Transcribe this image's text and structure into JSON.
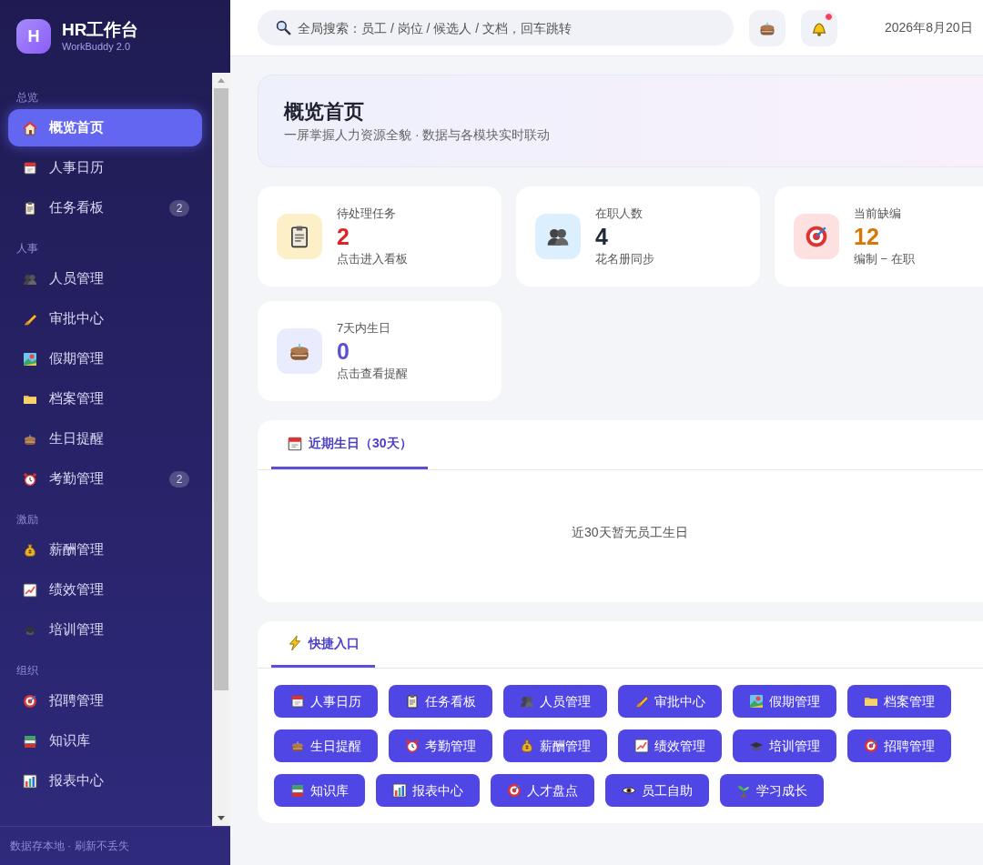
{
  "brand": {
    "logo_letter": "H",
    "title": "HR工作台",
    "subtitle": "WorkBuddy 2.0"
  },
  "sidebar": {
    "sections": [
      {
        "title": "总览",
        "items": [
          {
            "label": "概览首页",
            "selected": true
          },
          {
            "label": "人事日历",
            "selected": false
          },
          {
            "label": "任务看板",
            "selected": false,
            "badge": "2"
          }
        ]
      },
      {
        "title": "人事",
        "items": [
          {
            "label": "人员管理",
            "selected": false
          },
          {
            "label": "审批中心",
            "selected": false
          },
          {
            "label": "假期管理",
            "selected": false
          },
          {
            "label": "档案管理",
            "selected": false
          },
          {
            "label": "生日提醒",
            "selected": false
          },
          {
            "label": "考勤管理",
            "selected": false,
            "badge": "2"
          }
        ]
      },
      {
        "title": "激励",
        "items": [
          {
            "label": "薪酬管理",
            "selected": false
          },
          {
            "label": "绩效管理",
            "selected": false
          },
          {
            "label": "培训管理",
            "selected": false
          }
        ]
      },
      {
        "title": "组织",
        "items": [
          {
            "label": "招聘管理",
            "selected": false
          },
          {
            "label": "知识库",
            "selected": false
          },
          {
            "label": "报表中心",
            "selected": false
          }
        ]
      }
    ],
    "footer": "数据存本地 · 刷新不丢失"
  },
  "header": {
    "search": {
      "placeholder": "全局搜索：员工 / 岗位 / 候选人 / 文档，回车跳转"
    },
    "notification_dot": true,
    "date": "2026年8月20日"
  },
  "page": {
    "title": "概览首页",
    "subtitle": "一屏掌握人力资源全貌 · 数据与各模块实时联动"
  },
  "stats": [
    {
      "label": "待处理任务",
      "value": "2",
      "note": "点击进入看板",
      "color": "#dc2626"
    },
    {
      "label": "在职人数",
      "value": "4",
      "note": "花名册同步",
      "color": "#1f2937"
    },
    {
      "label": "当前缺编",
      "value": "12",
      "note": "编制 − 在职",
      "color": "#d97706"
    },
    {
      "label": "7天内生日",
      "value": "0",
      "note": "点击查看提醒",
      "color": "#5b4fd6"
    }
  ],
  "birthday_panel": {
    "tabs": [
      {
        "label": "近期生日（30天）",
        "selected": true
      }
    ],
    "empty_text": "近30天暂无员工生日"
  },
  "quick_panel": {
    "tabs": [
      {
        "label": "快捷入口",
        "selected": true
      }
    ],
    "buttons": [
      "人事日历",
      "任务看板",
      "人员管理",
      "审批中心",
      "假期管理",
      "档案管理",
      "生日提醒",
      "考勤管理",
      "薪酬管理",
      "绩效管理",
      "培训管理",
      "招聘管理",
      "知识库",
      "报表中心",
      "人才盘点",
      "员工自助",
      "学习成长"
    ]
  }
}
